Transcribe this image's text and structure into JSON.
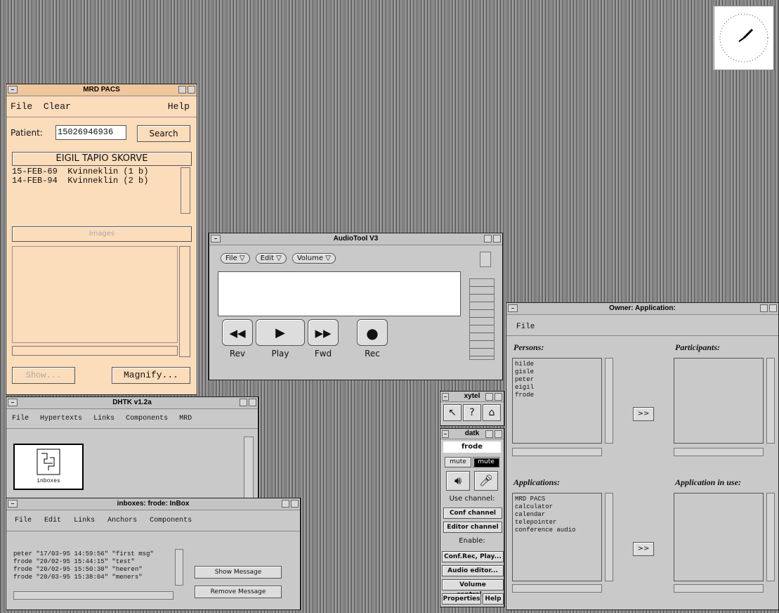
{
  "clock": {
    "label": "clock"
  },
  "mrd": {
    "title": "MRD PACS",
    "menu": [
      "File",
      "Clear"
    ],
    "help": "Help",
    "patient_label": "Patient:",
    "patient_value": "15026946936",
    "search": "Search",
    "patient_name": "EIGIL TAPIO SKORVE",
    "records": [
      "15-FEB-69  Kvinneklin (1 b)",
      "14-FEB-94  Kvinneklin (2 b)"
    ],
    "images_label": "Images",
    "show": "Show...",
    "magnify": "Magnify..."
  },
  "audio": {
    "title": "AudioTool V3",
    "menus": [
      "File ▽",
      "Edit ▽",
      "Volume ▽"
    ],
    "controls": [
      {
        "icon": "◀◀",
        "label": "Rev"
      },
      {
        "icon": "▶",
        "label": "Play"
      },
      {
        "icon": "▶▶",
        "label": "Fwd"
      },
      {
        "icon": "●",
        "label": "Rec"
      }
    ]
  },
  "owner": {
    "title": "Owner:  Application:",
    "menu": "File",
    "persons_label": "Persons:",
    "participants_label": "Participants:",
    "persons": [
      "hilde",
      "gisle",
      "peter",
      "eigil",
      "frode"
    ],
    "move_btn": ">>",
    "applications_label": "Applications:",
    "app_in_use_label": "Application in use:",
    "applications": [
      "MRD PACS",
      "calculator",
      "calendar",
      "telepointer",
      "conference audio"
    ]
  },
  "dhtk": {
    "title": "DHTK v1.2a",
    "menu": [
      "File",
      "Hypertexts",
      "Links",
      "Components",
      "MRD"
    ],
    "icon_label": "inboxes"
  },
  "inbox": {
    "title": "inboxes: frode: InBox",
    "menu": [
      "File",
      "Edit",
      "Links",
      "Anchors",
      "Components"
    ],
    "messages": [
      "peter \"17/03-95 14:59:56\" \"first msg\"",
      "frode \"20/02-95 15:44:15\" \"test\"",
      "frode \"20/02-95 15:50:30\" \"heeren\"",
      "frode \"20/03-95 15:38:04\" \"meners\""
    ],
    "show_msg": "Show Message",
    "remove_msg": "Remove Message"
  },
  "xytel": {
    "title": "xytel"
  },
  "datk": {
    "title": "datk",
    "user": "frode",
    "mute1": "mute",
    "mute2": "mute",
    "use_channel": "Use channel:",
    "conf_channel": "Conf channel",
    "editor_channel": "Editor channel",
    "enable": "Enable:",
    "conf_rec": "Conf.Rec, Play...",
    "audio_editor": "Audio editor...",
    "volume_control": "Volume control...",
    "properties": "Properties",
    "help": "Help"
  }
}
